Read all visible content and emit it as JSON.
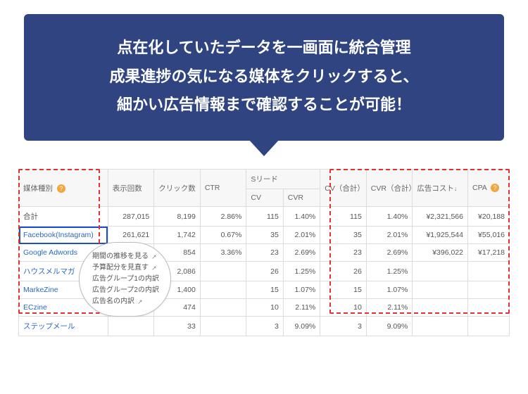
{
  "callout": {
    "line1": "点在化していたデータを一画面に統合管理",
    "line2": "成果進捗の気になる媒体をクリックすると、",
    "line3": "細かい広告情報まで確認することが可能！"
  },
  "table": {
    "headers": {
      "media": "媒体種別",
      "impressions": "表示回数",
      "clicks": "クリック数",
      "ctr": "CTR",
      "lead_group": "Sリード",
      "lead_cv": "CV",
      "lead_cvr": "CVR",
      "cv_total": "CV（合計）",
      "cvr_total": "CVR（合計）",
      "cost": "広告コスト",
      "cost_sort": "↓",
      "cpa": "CPA"
    },
    "rows": [
      {
        "media": "合計",
        "imp": "287,015",
        "clk": "8,199",
        "ctr": "2.86%",
        "cv": "115",
        "cvr": "1.40%",
        "cvT": "115",
        "cvrT": "1.40%",
        "cost": "¥2,321,566",
        "cpa": "¥20,188",
        "link": false
      },
      {
        "media": "Facebook(Instagram)",
        "imp": "261,621",
        "clk": "1,742",
        "ctr": "0.67%",
        "cv": "35",
        "cvr": "2.01%",
        "cvT": "35",
        "cvrT": "2.01%",
        "cost": "¥1,925,544",
        "cpa": "¥55,016",
        "link": true,
        "selected": true
      },
      {
        "media": "Google Adwords",
        "imp": "",
        "clk": "854",
        "ctr": "3.36%",
        "cv": "23",
        "cvr": "2.69%",
        "cvT": "23",
        "cvrT": "2.69%",
        "cost": "¥396,022",
        "cpa": "¥17,218",
        "link": true
      },
      {
        "media": "ハウスメルマガ",
        "imp": "",
        "clk": "2,086",
        "ctr": "",
        "cv": "26",
        "cvr": "1.25%",
        "cvT": "26",
        "cvrT": "1.25%",
        "cost": "",
        "cpa": "",
        "link": true
      },
      {
        "media": "MarkeZine",
        "imp": "",
        "clk": "1,400",
        "ctr": "",
        "cv": "15",
        "cvr": "1.07%",
        "cvT": "15",
        "cvrT": "1.07%",
        "cost": "",
        "cpa": "",
        "link": true
      },
      {
        "media": "ECzine",
        "imp": "",
        "clk": "474",
        "ctr": "",
        "cv": "10",
        "cvr": "2.11%",
        "cvT": "10",
        "cvrT": "2.11%",
        "cost": "",
        "cpa": "",
        "link": true
      },
      {
        "media": "ステップメール",
        "imp": "",
        "clk": "33",
        "ctr": "",
        "cv": "3",
        "cvr": "9.09%",
        "cvT": "3",
        "cvrT": "9.09%",
        "cost": "",
        "cpa": "",
        "link": true
      }
    ]
  },
  "popup": {
    "items": [
      "期間の推移を見る",
      "予算配分を見直す",
      "広告グループ1の内訳",
      "広告グループ2の内訳",
      "広告名の内訳"
    ]
  },
  "icons": {
    "help": "?",
    "external": "↗"
  }
}
